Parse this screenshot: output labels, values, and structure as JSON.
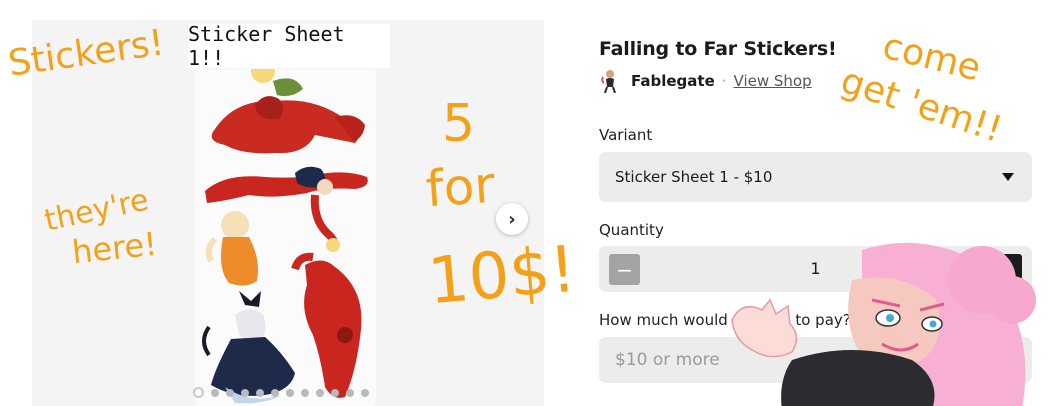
{
  "gallery": {
    "caption": "Sticker Sheet 1!!",
    "next_icon": "chevron-right-icon",
    "dot_count": 12,
    "active_dot": 0
  },
  "product": {
    "title": "Falling to Far Stickers!",
    "seller_name": "Fablegate",
    "separator": "·",
    "view_shop": "View Shop",
    "variant_label": "Variant",
    "variant_value": "Sticker Sheet 1 - $10",
    "quantity_label": "Quantity",
    "quantity_value": "1",
    "minus": "−",
    "plus": "+",
    "pay_label": "How much would you like to pay?",
    "pay_placeholder": "$10 or more"
  },
  "doodles": {
    "stickers": "Stickers!",
    "theyre": "they're",
    "here": "here!",
    "five": "5",
    "for": "for",
    "price": "10$!",
    "come": "come",
    "get": "get 'em!!"
  },
  "colors": {
    "doodle": "#f4a11a",
    "panel_bg": "#ececeb",
    "gallery_bg": "#f4f4f5"
  }
}
